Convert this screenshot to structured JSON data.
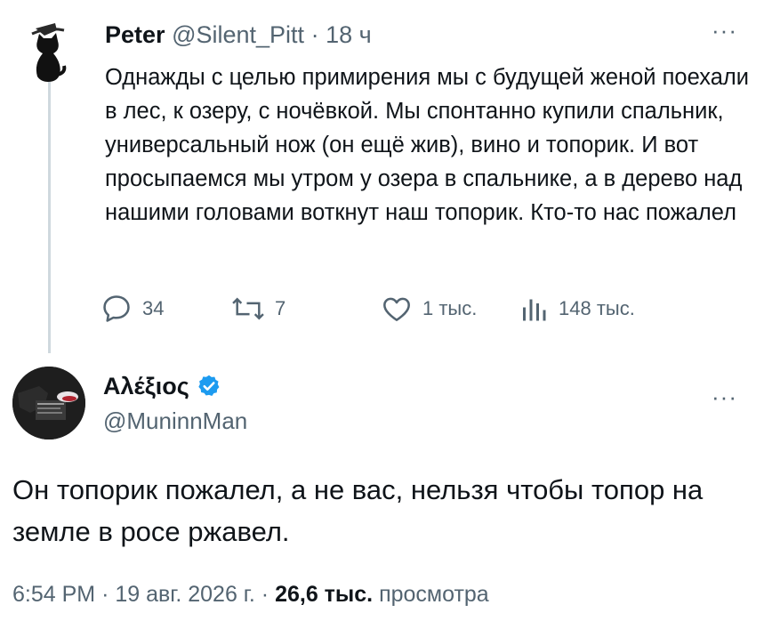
{
  "tweet1": {
    "author_name": "Peter",
    "author_handle": "@Silent_Pitt",
    "separator": "·",
    "time": "18 ч",
    "more_icon": "···",
    "text": "Однажды с целью примирения мы с будущей женой поехали в лес, к озеру, с ночёвкой. Мы спонтанно купили спальник, универсальный нож (он ещё жив), вино и топорик. И вот просыпаемся мы утром у озера в спальнике, а в дерево над нашими головами воткнут наш топорик. Кто-то нас пожалел",
    "actions": {
      "replies": "34",
      "reposts": "7",
      "likes": "1 тыс.",
      "views": "148 тыс."
    }
  },
  "tweet2": {
    "author_name": "Αλέξιος",
    "author_handle": "@MuninnMan",
    "verified": true,
    "more_icon": "···",
    "text": "Он топорик пожалел,  а не вас, нельзя чтобы топор на земле в росе  ржавел.",
    "time": "6:54 PM",
    "date": "19 авг. 2026 г.",
    "sep": "·",
    "views_count": "26,6 тыс.",
    "views_label": "просмотра"
  },
  "colors": {
    "text": "#0f1419",
    "muted": "#536471",
    "verified": "#1d9bf0",
    "thread_line": "#cfd9de"
  }
}
